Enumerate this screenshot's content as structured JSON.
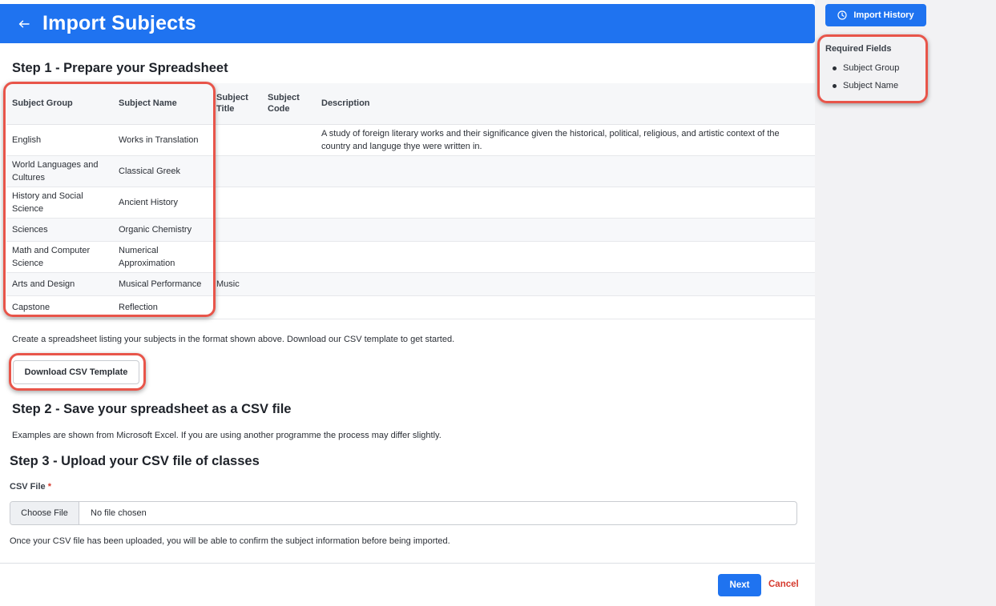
{
  "header": {
    "title": "Import Subjects"
  },
  "step1": {
    "title": "Step 1 - Prepare your Spreadsheet",
    "columns": [
      "Subject Group",
      "Subject Name",
      "Subject Title",
      "Subject Code",
      "Description"
    ],
    "rows": [
      [
        "English",
        "Works in Translation",
        "",
        "",
        "A study of foreign literary works and their significance given the historical, political, religious, and artistic context of the country and languge thye were written in."
      ],
      [
        "World Languages and Cultures",
        "Classical Greek",
        "",
        "",
        ""
      ],
      [
        "History and Social Science",
        "Ancient History",
        "",
        "",
        ""
      ],
      [
        "Sciences",
        "Organic Chemistry",
        "",
        "",
        ""
      ],
      [
        "Math and Computer Science",
        "Numerical Approximation",
        "",
        "",
        ""
      ],
      [
        "Arts and Design",
        "Musical Performance",
        "Music",
        "",
        ""
      ],
      [
        "Capstone",
        "Reflection",
        "",
        "",
        ""
      ]
    ],
    "instructions": "Create a spreadsheet listing your subjects in the format shown above. Download our CSV template to get started.",
    "download_label": "Download CSV Template"
  },
  "step2": {
    "title": "Step 2 - Save your spreadsheet as a CSV file",
    "text": "Examples are shown from Microsoft Excel. If you are using another programme the process may differ slightly."
  },
  "step3": {
    "title": "Step 3 - Upload your CSV file of classes",
    "field_label": "CSV File",
    "required_mark": "*",
    "choose_label": "Choose File",
    "file_status": "No file chosen",
    "note": "Once your CSV file has been uploaded, you will be able to confirm the subject information before being imported."
  },
  "footer": {
    "next_label": "Next",
    "cancel_label": "Cancel"
  },
  "sidebar": {
    "history_label": "Import History",
    "required_title": "Required Fields",
    "required_items": [
      "Subject Group",
      "Subject Name"
    ]
  },
  "colors": {
    "primary": "#1f73f0",
    "danger": "#d63a2e",
    "highlight": "#e8554a"
  }
}
